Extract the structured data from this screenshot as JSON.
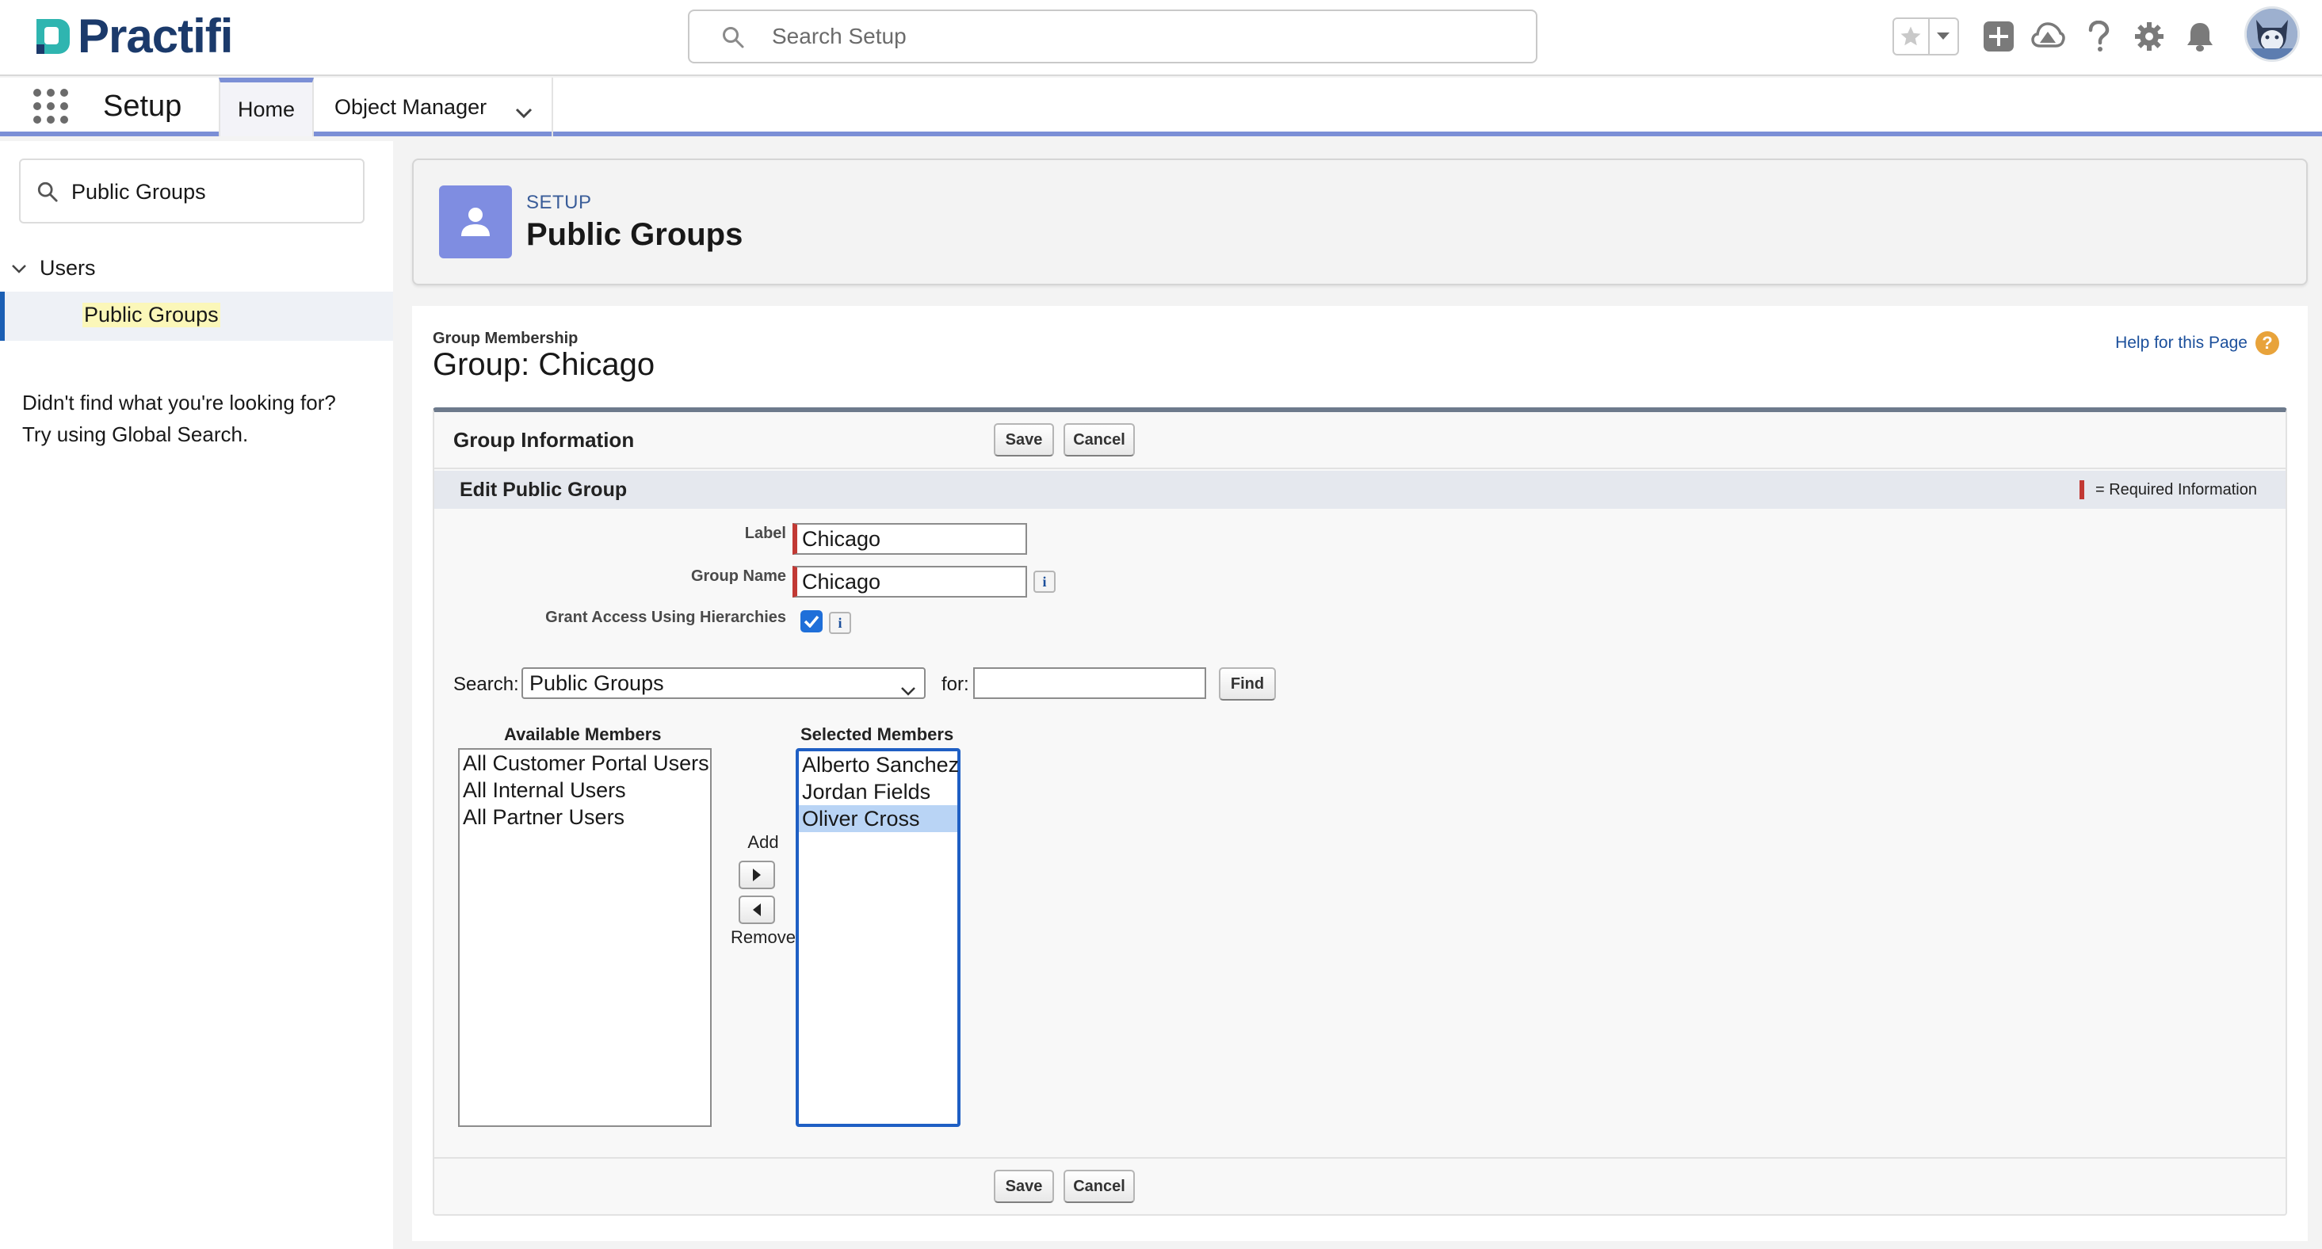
{
  "colors": {
    "brand": "#1b3a6b",
    "brand_accent": "#2fb5b0",
    "nav_accent": "#7b8fd6",
    "header_icon_bg": "#7f8de1",
    "link": "#1b4f9b",
    "required": "#c23934",
    "selected_option": "#b9d4f5"
  },
  "header": {
    "logo_text": "Practifi",
    "search_placeholder": "Search Setup",
    "icons": [
      "star-icon",
      "chevron-down-icon",
      "add-icon",
      "trailhead-icon",
      "help-icon",
      "gear-icon",
      "bell-icon",
      "avatar"
    ]
  },
  "nav": {
    "app_name": "Setup",
    "tabs": [
      {
        "label": "Home"
      },
      {
        "label": "Object Manager"
      }
    ]
  },
  "sidebar": {
    "search_value": "Public Groups",
    "section": "Users",
    "selected_item": "Public Groups",
    "help_line1": "Didn't find what you're looking for?",
    "help_line2": "Try using Global Search."
  },
  "page_header": {
    "kicker": "SETUP",
    "title": "Public Groups"
  },
  "content": {
    "subtitle": "Group Membership",
    "title": "Group: Chicago",
    "help_link": "Help for this Page",
    "help_glyph": "?"
  },
  "panel": {
    "title": "Group Information",
    "save_label": "Save",
    "cancel_label": "Cancel",
    "section_title": "Edit Public Group",
    "required_legend": "= Required Information",
    "fields": {
      "label_label": "Label",
      "label_value": "Chicago",
      "group_name_label": "Group Name",
      "group_name_value": "Chicago",
      "grant_access_label": "Grant Access Using Hierarchies",
      "grant_access_checked": true,
      "info_glyph": "i"
    },
    "search": {
      "label": "Search:",
      "selected": "Public Groups",
      "for_label": "for:",
      "for_value": "",
      "find_label": "Find"
    },
    "available": {
      "title": "Available Members",
      "items": [
        "All Customer Portal Users",
        "All Internal Users",
        "All Partner Users"
      ]
    },
    "selected": {
      "title": "Selected Members",
      "items": [
        "Alberto Sanchez",
        "Jordan Fields",
        "Oliver Cross"
      ],
      "highlighted_index": 2
    },
    "add_label": "Add",
    "remove_label": "Remove"
  }
}
